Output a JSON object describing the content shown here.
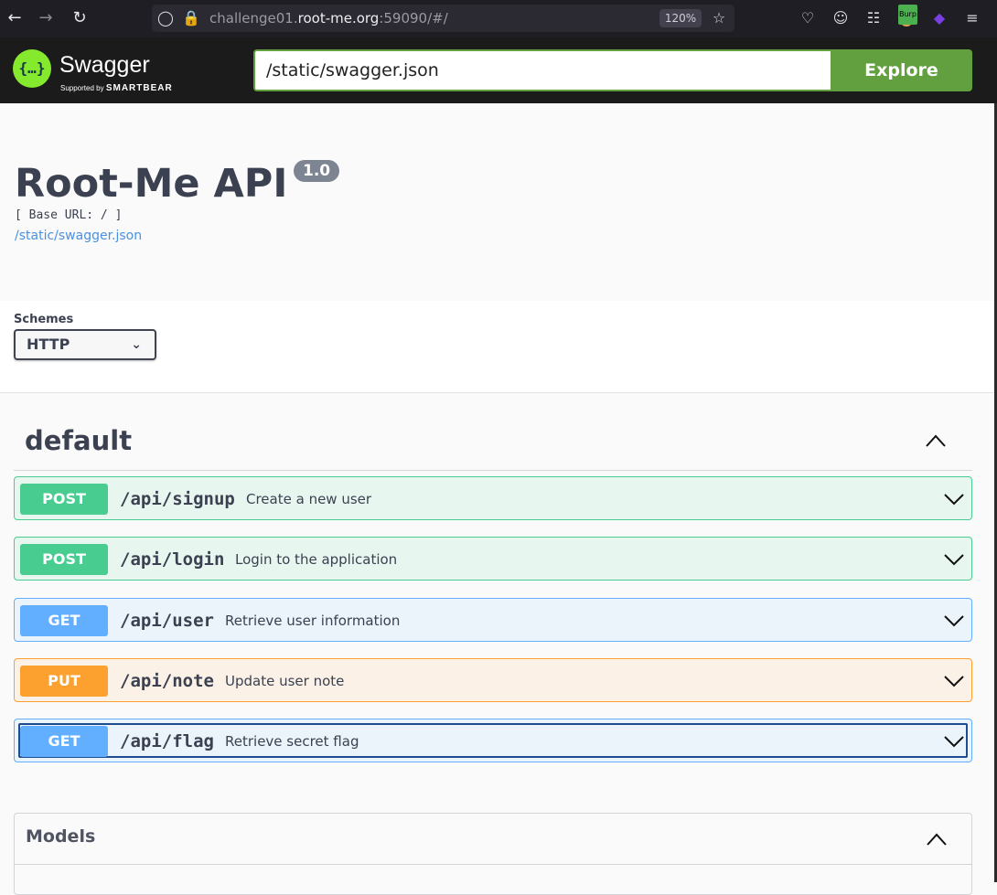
{
  "browser": {
    "url_prefix": "challenge01.",
    "url_host": "root-me.org",
    "url_suffix": ":59090/#/",
    "zoom": "120%",
    "extension_badge": "Burp"
  },
  "topbar": {
    "logo_text": "Swagger",
    "logo_sub_prefix": "Supported by",
    "logo_sub_brand": "SMARTBEAR",
    "spec_url": "/static/swagger.json",
    "explore_label": "Explore"
  },
  "info": {
    "title": "Root-Me API",
    "version": "1.0",
    "base_url": "[ Base URL: / ]",
    "spec_link": "/static/swagger.json"
  },
  "schemes": {
    "label": "Schemes",
    "selected": "HTTP"
  },
  "tag": {
    "name": "default"
  },
  "operations": [
    {
      "method": "POST",
      "path": "/api/signup",
      "summary": "Create a new user"
    },
    {
      "method": "POST",
      "path": "/api/login",
      "summary": "Login to the application"
    },
    {
      "method": "GET",
      "path": "/api/user",
      "summary": "Retrieve user information"
    },
    {
      "method": "PUT",
      "path": "/api/note",
      "summary": "Update user note"
    },
    {
      "method": "GET",
      "path": "/api/flag",
      "summary": "Retrieve secret flag"
    }
  ],
  "models": {
    "title": "Models"
  },
  "colors": {
    "post": "#49cc90",
    "get": "#61affe",
    "put": "#fca130",
    "swagger_green": "#62a03f"
  }
}
